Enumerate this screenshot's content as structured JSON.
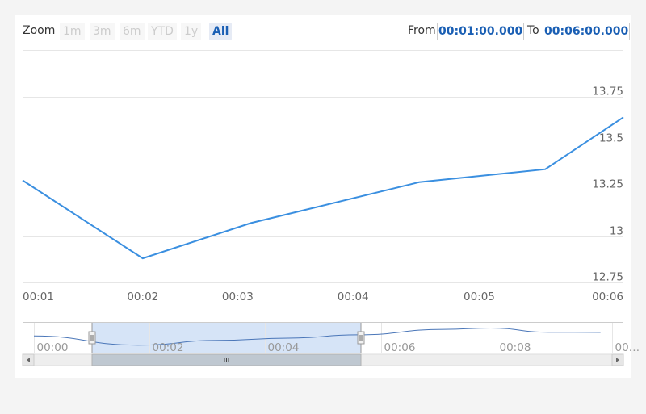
{
  "toolbar": {
    "zoom_label": "Zoom",
    "buttons": [
      "1m",
      "3m",
      "6m",
      "YTD",
      "1y",
      "All"
    ],
    "active_button": "All",
    "from_label": "From",
    "from_value": "00:01:00.000",
    "to_label": "To",
    "to_value": "00:06:00.000"
  },
  "colors": {
    "series": "#3a8fe0",
    "navigator_series": "#4a76b8",
    "navigator_mask": "#d6e4f7",
    "grid": "#e6e6e6",
    "accent": "#1a5fb4"
  },
  "chart_data": {
    "type": "line",
    "x_unit": "minutes",
    "x": [
      1.0,
      2.0,
      2.9,
      4.3,
      5.35,
      6.0
    ],
    "series": [
      {
        "values": [
          13.3,
          12.88,
          13.07,
          13.29,
          13.36,
          13.64
        ]
      }
    ],
    "ylim": [
      12.75,
      13.75
    ],
    "y_ticks": [
      "12.75",
      "13",
      "13.25",
      "13.5",
      "13.75"
    ],
    "xlim": [
      1,
      6
    ],
    "x_ticks": [
      {
        "label": "00:01",
        "x": 1
      },
      {
        "label": "00:02",
        "x": 2
      },
      {
        "label": "00:03",
        "x": 2.79
      },
      {
        "label": "00:04",
        "x": 3.75
      },
      {
        "label": "00:05",
        "x": 4.8
      },
      {
        "label": "00:06",
        "x": 6
      }
    ],
    "grid": true,
    "y_axis_position": "right",
    "navigator": {
      "x_ticks": [
        "00:00",
        "00:02",
        "00:04",
        "00:06",
        "00:08",
        "00…"
      ],
      "selected_range_label": "00:01 to 00:06",
      "series_x": [
        0,
        1.8,
        3.2,
        4.4,
        5.6,
        7.1,
        7.9,
        8.9,
        9.8
      ],
      "series_values": [
        13.3,
        12.88,
        13.1,
        13.2,
        13.35,
        13.6,
        13.66,
        13.47,
        13.46
      ]
    }
  }
}
